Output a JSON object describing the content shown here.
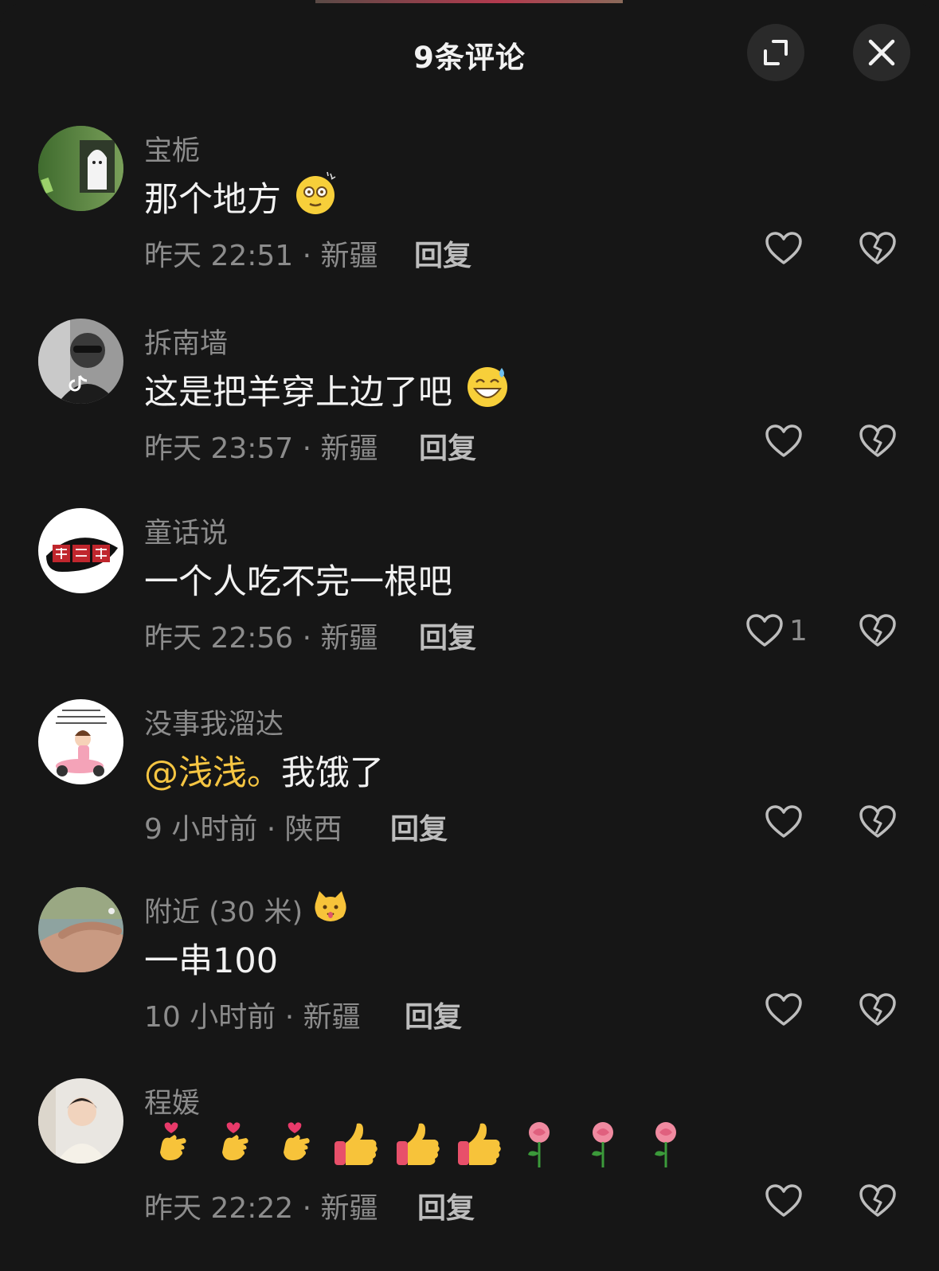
{
  "header": {
    "title": "9条评论",
    "expand_icon": "expand-icon",
    "close_icon": "close-icon"
  },
  "colors": {
    "background": "#161616",
    "username": "#8c8c8c",
    "text": "#f2f2f2",
    "mention": "#f5c542",
    "button_bg": "#2a2a2a"
  },
  "comments": [
    {
      "username": "宝栀",
      "text": "那个地方",
      "text_emoji": "dizzy-face-emoji",
      "meta": "昨天 22:51 · 新疆",
      "reply_label": "回复",
      "likes": ""
    },
    {
      "username": "拆南墙",
      "text": "这是把羊穿上边了吧",
      "text_emoji": "grinning-sweat-emoji",
      "meta": "昨天 23:57 · 新疆",
      "reply_label": "回复",
      "likes": ""
    },
    {
      "username": "童话说",
      "text": "一个人吃不完一根吧",
      "meta": "昨天 22:56 · 新疆",
      "reply_label": "回复",
      "likes": "1"
    },
    {
      "username": "没事我溜达",
      "mention": "@浅浅。",
      "text": "我饿了",
      "meta": "9 小时前 · 陕西",
      "reply_label": "回复",
      "likes": ""
    },
    {
      "username": "附近 (30 米)",
      "username_emoji": "cat-face-emoji",
      "text": "一串100",
      "meta": "10 小时前 · 新疆",
      "reply_label": "回复",
      "likes": ""
    },
    {
      "username": "程媛",
      "text_emojis": [
        "hand-heart-emoji",
        "hand-heart-emoji",
        "hand-heart-emoji",
        "thumbs-up-emoji",
        "thumbs-up-emoji",
        "thumbs-up-emoji",
        "rose-emoji",
        "rose-emoji",
        "rose-emoji"
      ],
      "meta": "昨天 22:22 · 新疆",
      "reply_label": "回复",
      "likes": ""
    }
  ]
}
